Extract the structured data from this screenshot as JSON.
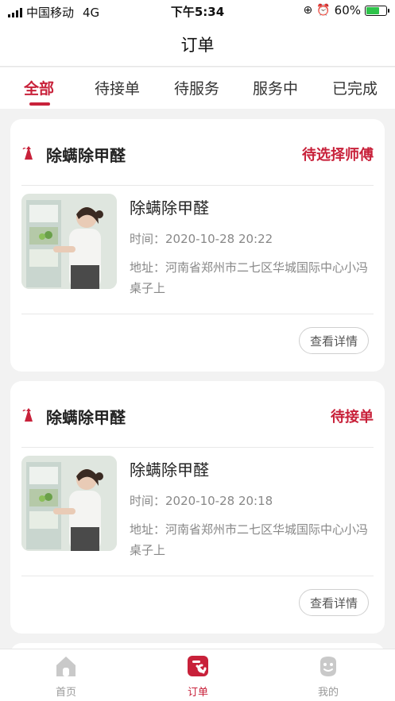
{
  "status_bar": {
    "carrier": "中国移动",
    "network": "4G",
    "time": "下午5:34",
    "battery": "60%"
  },
  "nav": {
    "title": "订单"
  },
  "tabs": [
    {
      "label": "全部",
      "active": true
    },
    {
      "label": "待接单",
      "active": false
    },
    {
      "label": "待服务",
      "active": false
    },
    {
      "label": "服务中",
      "active": false
    },
    {
      "label": "已完成",
      "active": false
    }
  ],
  "orders": [
    {
      "title": "除螨除甲醛",
      "status": "待选择师傅",
      "service": "除螨除甲醛",
      "time": "时间：2020-10-28 20:22",
      "address": "地址：河南省郑州市二七区华城国际中心小冯桌子上",
      "button": "查看详情"
    },
    {
      "title": "除螨除甲醛",
      "status": "待接单",
      "service": "除螨除甲醛",
      "time": "时间：2020-10-28 20:18",
      "address": "地址：河南省郑州市二七区华城国际中心小冯桌子上",
      "button": "查看详情"
    }
  ],
  "bottom_nav": [
    {
      "label": "首页",
      "icon": "home-icon",
      "active": false
    },
    {
      "label": "订单",
      "icon": "order-wrench-icon",
      "active": true
    },
    {
      "label": "我的",
      "icon": "profile-face-icon",
      "active": false
    }
  ],
  "colors": {
    "accent": "#c8213a",
    "background": "#f2f2f2"
  }
}
